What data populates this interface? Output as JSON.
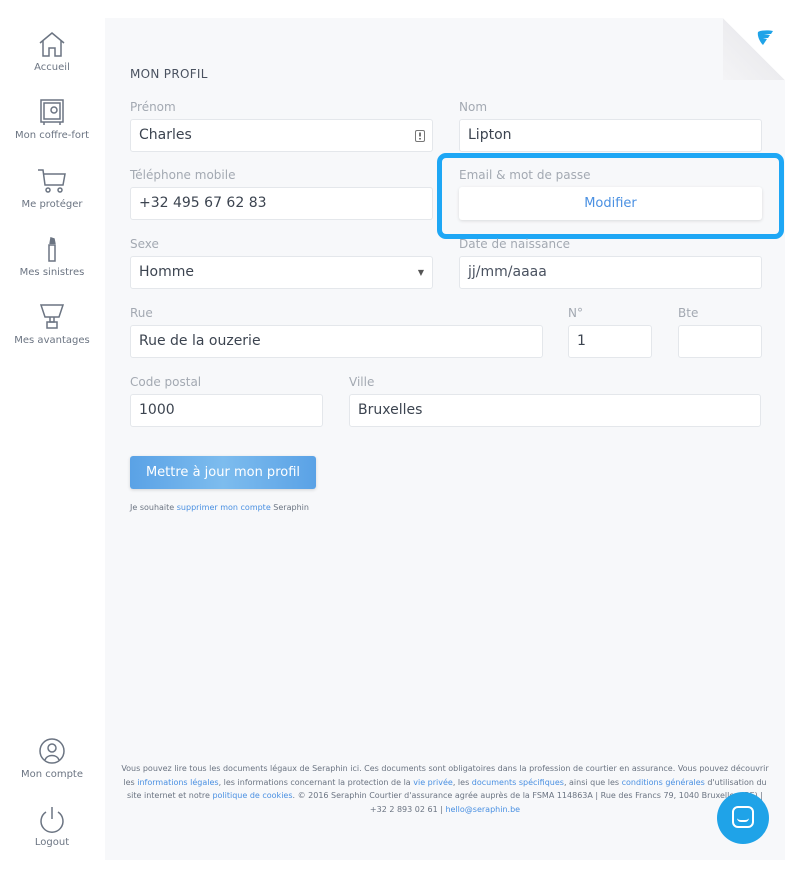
{
  "sidebar": {
    "items": [
      {
        "label": "Accueil",
        "icon": "home-icon"
      },
      {
        "label": "Mon coffre-fort",
        "icon": "safe-icon"
      },
      {
        "label": "Me protéger",
        "icon": "cart-icon"
      },
      {
        "label": "Mes sinistres",
        "icon": "extinguisher-icon"
      },
      {
        "label": "Mes avantages",
        "icon": "trophy-icon"
      }
    ],
    "bottom": [
      {
        "label": "Mon compte",
        "icon": "user-icon"
      },
      {
        "label": "Logout",
        "icon": "power-icon"
      }
    ]
  },
  "profile": {
    "title": "MON PROFIL",
    "prenom": {
      "label": "Prénom",
      "value": "Charles"
    },
    "nom": {
      "label": "Nom",
      "value": "Lipton"
    },
    "telephone": {
      "label": "Téléphone mobile",
      "value": "+32 495 67 62 83"
    },
    "email": {
      "label": "Email & mot de passe",
      "button": "Modifier"
    },
    "sexe": {
      "label": "Sexe",
      "value": "Homme"
    },
    "naissance": {
      "label": "Date de naissance",
      "placeholder": "jj/mm/aaaa"
    },
    "rue": {
      "label": "Rue",
      "value": "Rue de la ouzerie"
    },
    "numero": {
      "label": "N°",
      "value": "1"
    },
    "boite": {
      "label": "Bte",
      "value": ""
    },
    "code_postal": {
      "label": "Code postal",
      "value": "1000"
    },
    "ville": {
      "label": "Ville",
      "value": "Bruxelles"
    },
    "update_button": "Mettre à jour mon profil",
    "delete": {
      "pre": "Je souhaite ",
      "link": "supprimer mon compte",
      "post": " Seraphin"
    }
  },
  "footer": {
    "t1": "Vous pouvez lire tous les documents légaux de Seraphin ici. Ces documents sont obligatoires dans la profession de courtier en assurance. Vous pouvez découvrir les ",
    "l1": "informations légales",
    "t2": ", les informations concernant la protection de la ",
    "l2": "vie privée",
    "t3": ", les ",
    "l3": "documents spécifiques",
    "t4": ", ainsi que les ",
    "l4": "conditions générales",
    "t5": " d'utilisation du site internet et notre ",
    "l5": "politique de cookies",
    "t6": ". © 2016 Seraphin Courtier d'assurance agrée auprès de la FSMA 114863A | Rue des Francs 79, 1040 Bruxelles (BE) | +32 2 893 02 61 | ",
    "l6": "hello@seraphin.be"
  },
  "colors": {
    "accent": "#1ea7f5",
    "link": "#4a90e2"
  }
}
